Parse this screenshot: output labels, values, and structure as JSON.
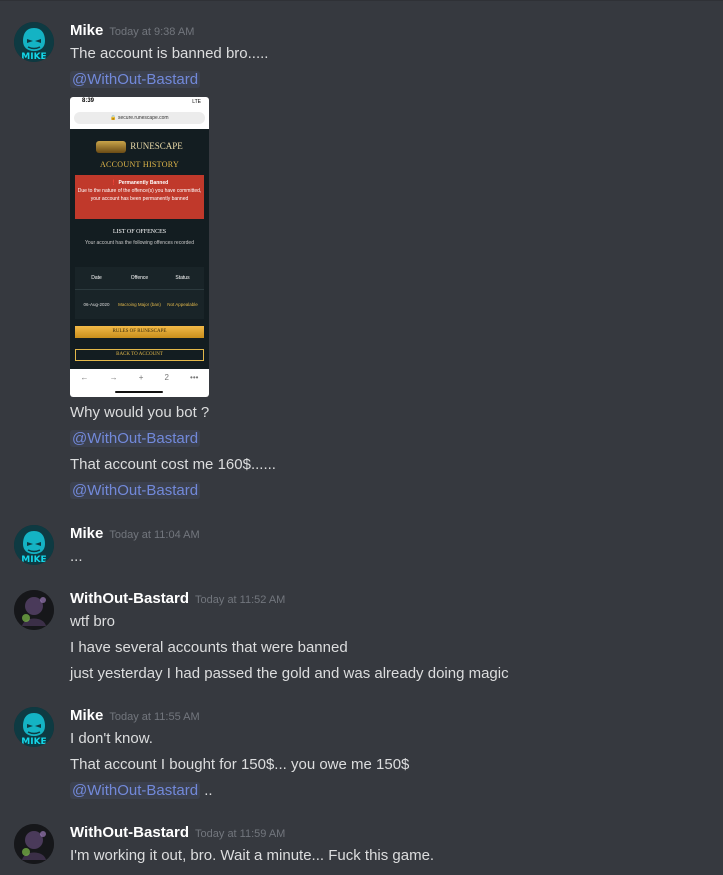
{
  "messages": [
    {
      "author": "Mike",
      "timestamp": "Today at 9:38 AM",
      "lines": [
        "The account is banned bro.....",
        "@WithOut-Bastard",
        "Why would you bot ?",
        "@WithOut-Bastard",
        "That account cost me 160$......",
        "@WithOut-Bastard"
      ]
    },
    {
      "author": "Mike",
      "timestamp": "Today at 11:04 AM",
      "lines": [
        "..."
      ]
    },
    {
      "author": "WithOut-Bastard",
      "timestamp": "Today at 11:52 AM",
      "lines": [
        "wtf bro",
        "I have several accounts that were banned",
        "just yesterday I had passed the gold and was already doing magic"
      ]
    },
    {
      "author": "Mike",
      "timestamp": "Today at 11:55 AM",
      "lines": [
        "I don't know.",
        "That account I bought for 150$... you owe me 150$",
        "@WithOut-Bastard",
        ".."
      ]
    },
    {
      "author": "WithOut-Bastard",
      "timestamp": "Today at 11:59 AM",
      "lines": [
        "I'm working it out, bro. Wait a minute... Fuck this game."
      ]
    }
  ],
  "avatars": {
    "mike_label": "MIKE"
  },
  "attachment": {
    "status_time": "8:39",
    "status_indicators": "LTE",
    "url": "secure.runescape.com",
    "logo_text": "RUNESCAPE",
    "title": "ACCOUNT HISTORY",
    "ban_title": "Permanently Banned",
    "ban_text": "Due to the nature of the offence(s) you have committed, your account has been permanently banned",
    "list_title": "LIST OF OFFENCES",
    "list_sub": "Your account has the following offences recorded",
    "table": {
      "headers": [
        "Date",
        "Offence",
        "Status"
      ],
      "row": [
        "06-Aug-2020",
        "Macroing Major (ban)",
        "Not Appealable"
      ]
    },
    "rules_button": "RULES OF RUNESCAPE",
    "back_button": "BACK TO ACCOUNT",
    "nav_icons": [
      "←",
      "→",
      "+",
      "2",
      "•••"
    ]
  },
  "colors": {
    "background": "#36393f",
    "mention": "#7289da",
    "ban_red": "#c0392b",
    "gold": "#e2b84a"
  }
}
